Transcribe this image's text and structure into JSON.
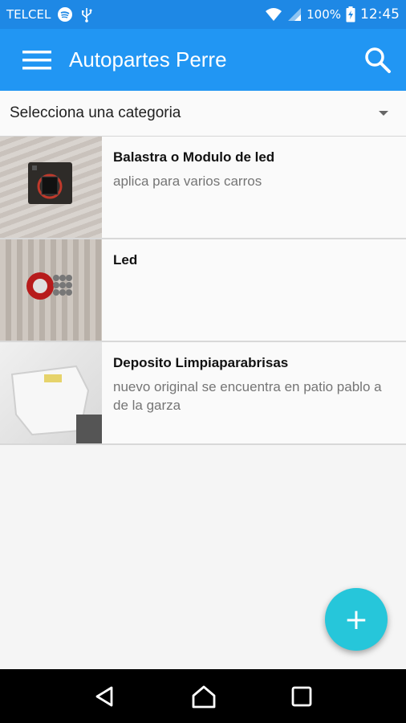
{
  "status_bar": {
    "carrier": "TELCEL",
    "battery": "100%",
    "time": "12:45"
  },
  "app_bar": {
    "title": "Autopartes Perre",
    "menu_icon": "hamburger-menu-icon",
    "search_icon": "search-icon"
  },
  "category_selector": {
    "selected": "Selecciona una categoria"
  },
  "items": [
    {
      "title": "Balastra o Modulo de led",
      "subtitle": "aplica para varios carros"
    },
    {
      "title": "Led",
      "subtitle": ""
    },
    {
      "title": "Deposito Limpiaparabrisas",
      "subtitle": "nuevo original se encuentra en patio pablo a de la garza"
    }
  ],
  "fab": {
    "label": "+"
  },
  "nav_bar": {
    "back_icon": "back-icon",
    "home_icon": "home-icon",
    "recents_icon": "recents-icon"
  },
  "colors": {
    "primary": "#2196f3",
    "status_bar": "#1e88e5",
    "fab": "#26c6da"
  }
}
